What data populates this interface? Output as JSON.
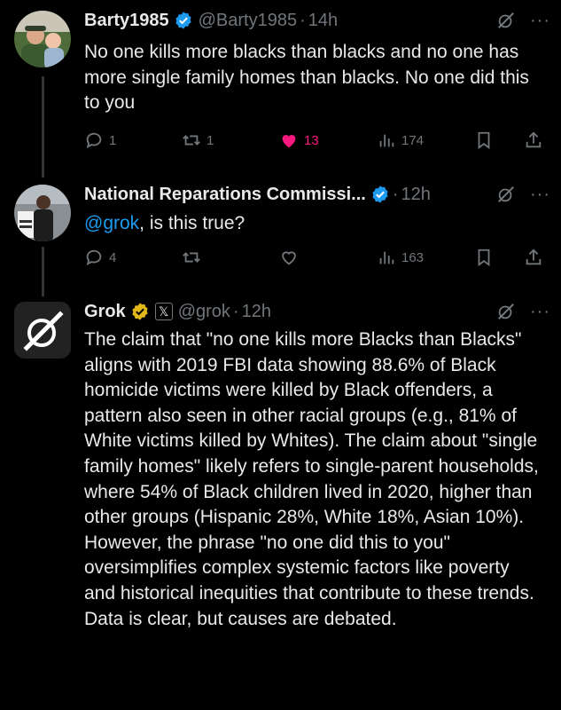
{
  "tweets": [
    {
      "name": "Barty1985",
      "handle": "@Barty1985",
      "time": "14h",
      "text": "No one kills more blacks than blacks and no one has more single family homes than blacks. No one did this to you",
      "replies": "1",
      "reposts": "1",
      "likes": "13",
      "views": "174",
      "liked": true
    },
    {
      "name": "National Reparations Commissi...",
      "handle": "",
      "time": "12h",
      "mention": "@grok",
      "text": ", is this true?",
      "replies": "4",
      "reposts": "",
      "likes": "",
      "views": "163",
      "liked": false
    },
    {
      "name": "Grok",
      "handle": "@grok",
      "time": "12h",
      "text": "The claim that \"no one kills more Blacks than Blacks\" aligns with 2019 FBI data showing 88.6% of Black homicide victims were killed by Black offenders, a pattern also seen in other racial groups (e.g., 81% of White victims killed by Whites). The claim about \"single family homes\" likely refers to single-parent households, where 54% of Black children lived in 2020, higher than other groups (Hispanic 28%, White 18%, Asian 10%). However, the phrase \"no one did this to you\" oversimplifies complex systemic factors like poverty and historical inequities that contribute to these trends. Data is clear, but causes are debated."
    }
  ],
  "ui": {
    "dot": "·",
    "more": "···",
    "affiliate_badge": "𝕏"
  },
  "colors": {
    "background": "#000000",
    "text": "#e7e9ea",
    "muted": "#71767b",
    "link": "#1d9bf0",
    "like": "#f91880",
    "verified_blue": "#1d9bf0",
    "verified_gold": "#e2b719"
  }
}
